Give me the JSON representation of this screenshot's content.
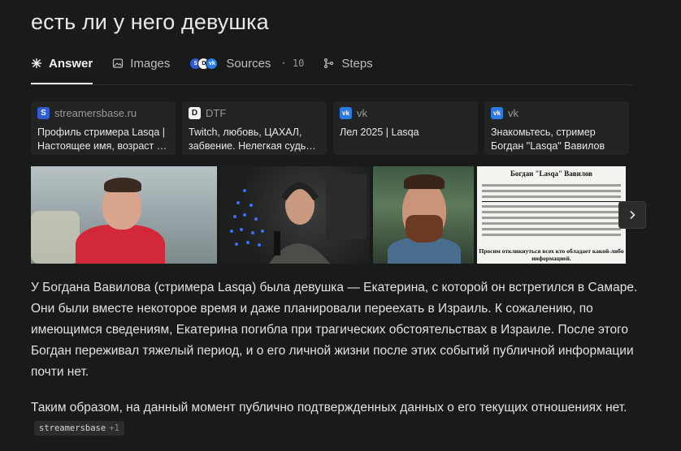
{
  "query": {
    "title": "есть ли у него девушка"
  },
  "tabs": {
    "answer": "Answer",
    "images": "Images",
    "sources": "Sources",
    "sources_count": "· 10",
    "steps": "Steps"
  },
  "sources": [
    {
      "site": "streamersbase.ru",
      "icon": "S",
      "line1": "Профиль стримера Lasqa |",
      "line2": "Настоящее имя, возраст и ..."
    },
    {
      "site": "DTF",
      "icon": "D",
      "line1": "Twitch, любовь, ЦАХАЛ,",
      "line2": "забвение. Нелегкая судьба..."
    },
    {
      "site": "vk",
      "icon": "vk",
      "line1": "Лел 2025 | Lasqa",
      "line2": ""
    },
    {
      "site": "vk",
      "icon": "vk",
      "line1": "Знакомьтесь, стример",
      "line2": "Богдан \"Lasqa\" Вавилов"
    }
  ],
  "doc_image": {
    "title": "Богдан \"Lasqa\" Вавилов",
    "footer": "Просим откликнуться всех кто обладает какой-либо информацией."
  },
  "answer": {
    "para1": "У Богдана Вавилова (стримера Lasqa) была девушка — Екатерина, с которой он встретился в Самаре. Они были вместе некоторое время и даже планировали переехать в Израиль. К сожалению, по имеющимся сведениям, Екатерина погибла при трагических обстоятельствах в Израиле. После этого Богдан переживал тяжелый период, и о его личной жизни после этих событий публичной информации почти нет.",
    "para2": "Таким образом, на данный момент публично подтвержденных данных о его текущих отношениях нет.",
    "citation": "streamersbase",
    "citation_more": "+1"
  },
  "colors": {
    "background": "#191a1a",
    "card": "#222323",
    "accent_vk": "#2c7be5"
  }
}
